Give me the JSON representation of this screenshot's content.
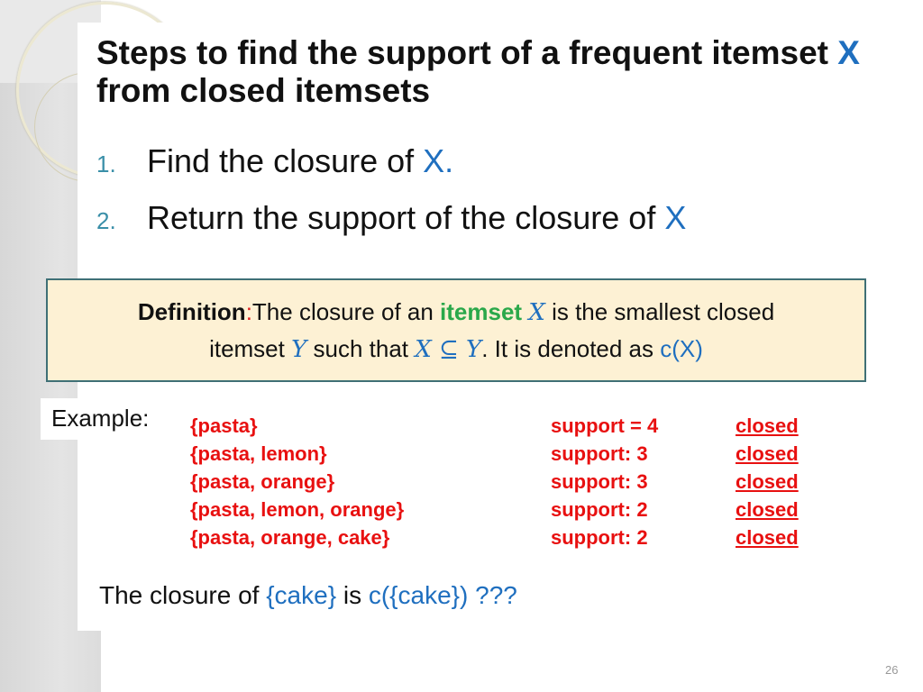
{
  "slide": {
    "title_part1": "Steps to find the support of a frequent itemset ",
    "title_x": "X",
    "title_part2": " from closed itemsets",
    "steps": [
      {
        "num": "1.",
        "text": "Find the closure of ",
        "x": "X."
      },
      {
        "num": "2.",
        "text": "Return the support of the closure of ",
        "x": "X"
      }
    ],
    "definition": {
      "label": "Definition",
      "colon": ":",
      "text1": "The closure of an ",
      "highlight": "itemset",
      "var_x": "X",
      "text2": " is the smallest closed",
      "text3": "itemset ",
      "var_y": "Y",
      "text4": " such that ",
      "subset_expr": "X ⊆ Y",
      "text5": ". It is denoted as ",
      "notation": "c(X)"
    },
    "example": {
      "label": "Example:",
      "rows": [
        {
          "itemset": "{pasta}",
          "support": "support = 4",
          "status": "closed"
        },
        {
          "itemset": "{pasta, lemon}",
          "support": "support: 3",
          "status": "closed"
        },
        {
          "itemset": "{pasta, orange}",
          "support": "support: 3",
          "status": "closed"
        },
        {
          "itemset": "{pasta, lemon, orange}",
          "support": "support: 2",
          "status": "closed"
        },
        {
          "itemset": "{pasta, orange, cake}",
          "support": "support: 2",
          "status": "closed"
        }
      ]
    },
    "closure_question": {
      "text1": "The closure of  ",
      "set": "{cake}",
      "text2": " is  ",
      "expr": "c({cake}) ???"
    },
    "page_number": "26",
    "colors": {
      "accent_blue": "#1f6fbf",
      "example_red": "#e81010",
      "highlight_green": "#2aa84a",
      "def_box_bg": "#fdf1d4",
      "def_box_border": "#3f7076"
    }
  }
}
